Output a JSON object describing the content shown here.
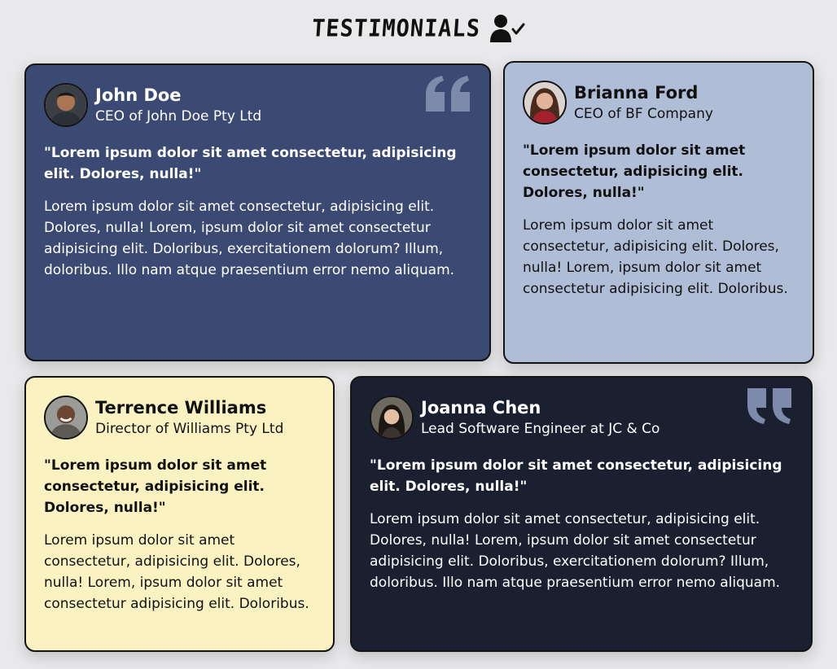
{
  "header": {
    "title": "TESTIMONIALS",
    "icon": "user-check-icon"
  },
  "colors": {
    "page_bg": "#e9e9eb",
    "card_blue": "#3b4a72",
    "card_light_blue": "#b0bdd7",
    "card_yellow": "#faf2c0",
    "card_dark": "#1b2031",
    "quote_mark": "#7e8aab"
  },
  "testimonials": [
    {
      "name": "John Doe",
      "role": "CEO of John Doe Pty Ltd",
      "headline": "\"Lorem ipsum dolor sit amet consectetur, adipisicing elit. Dolores, nulla!\"",
      "body": "Lorem ipsum dolor sit amet consectetur, adipisicing elit. Dolores, nulla! Lorem, ipsum dolor sit amet consectetur adipisicing elit. Doloribus, exercitationem dolorum? Illum, doloribus. Illo nam atque praesentium error nemo aliquam.",
      "decoration": "open-quote-icon"
    },
    {
      "name": "Brianna Ford",
      "role": "CEO of BF Company",
      "headline": "\"Lorem ipsum dolor sit amet consectetur, adipisicing elit. Dolores, nulla!\"",
      "body": "Lorem ipsum dolor sit amet consectetur, adipisicing elit. Dolores, nulla! Lorem, ipsum dolor sit amet consectetur adipisicing elit. Doloribus."
    },
    {
      "name": "Terrence Williams",
      "role": "Director of Williams Pty Ltd",
      "headline": "\"Lorem ipsum dolor sit amet consectetur, adipisicing elit. Dolores, nulla!\"",
      "body": "Lorem ipsum dolor sit amet consectetur, adipisicing elit. Dolores, nulla! Lorem, ipsum dolor sit amet consectetur adipisicing elit. Doloribus."
    },
    {
      "name": "Joanna Chen",
      "role": "Lead Software Engineer at JC & Co",
      "headline": "\"Lorem ipsum dolor sit amet consectetur, adipisicing elit. Dolores, nulla!\"",
      "body": "Lorem ipsum dolor sit amet consectetur, adipisicing elit. Dolores, nulla! Lorem, ipsum dolor sit amet consectetur adipisicing elit. Doloribus, exercitationem dolorum? Illum, doloribus. Illo nam atque praesentium error nemo aliquam.",
      "decoration": "close-quote-icon"
    }
  ]
}
